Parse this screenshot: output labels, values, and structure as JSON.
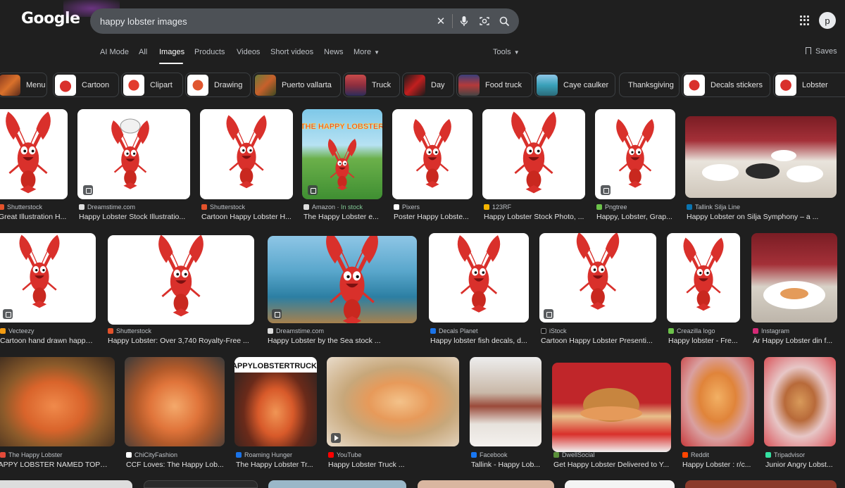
{
  "header": {
    "logo": "Google",
    "search_value": "happy lobster images",
    "avatar_letter": "p"
  },
  "nav": {
    "tabs": [
      "AI Mode",
      "All",
      "Images",
      "Products",
      "Videos",
      "Short videos",
      "News",
      "More"
    ],
    "active_tab": "Images",
    "tools": "Tools",
    "saves": "Saves"
  },
  "chips": [
    "Menu",
    "Cartoon",
    "Clipart",
    "Drawing",
    "Puerto vallarta",
    "Truck",
    "Day",
    "Food truck",
    "Caye caulker",
    "Thanksgiving",
    "Decals stickers",
    "Lobster"
  ],
  "results": {
    "row1": [
      {
        "source": "Shutterstock",
        "title": "Great Illustration H..."
      },
      {
        "source": "Dreamstime.com",
        "title": "Happy Lobster Stock Illustratio..."
      },
      {
        "source": "Shutterstock",
        "title": "Cartoon Happy Lobster H..."
      },
      {
        "source": "Amazon",
        "stock": "In stock",
        "title": "The Happy Lobster e..."
      },
      {
        "source": "Pixers",
        "title": "Poster Happy Lobste..."
      },
      {
        "source": "123RF",
        "title": "Happy Lobster Stock Photo, ..."
      },
      {
        "source": "Pngtree",
        "title": "Happy, Lobster, Grap..."
      },
      {
        "source": "Tallink Silja Line",
        "title": "Happy Lobster on Silja Symphony – a ..."
      }
    ],
    "row2": [
      {
        "source": "Vecteezy",
        "title": "Cartoon hand drawn happy ..."
      },
      {
        "source": "Shutterstock",
        "title": "Happy Lobster: Over 3,740 Royalty-Free ..."
      },
      {
        "source": "Dreamstime.com",
        "title": "Happy Lobster by the Sea stock ..."
      },
      {
        "source": "Decals Planet",
        "title": "Happy lobster fish decals, d..."
      },
      {
        "source": "iStock",
        "title": "Cartoon Happy Lobster Presenti..."
      },
      {
        "source": "Creazilla logo",
        "title": "Happy lobster - Fre..."
      },
      {
        "source": "Instagram",
        "title": "Är Happy Lobster din f..."
      }
    ],
    "row3": [
      {
        "source": "The Happy Lobster",
        "title": "HAPPY LOBSTER NAMED TOP ..."
      },
      {
        "source": "ChiCityFashion",
        "title": "CCF Loves: The Happy Lob..."
      },
      {
        "source": "Roaming Hunger",
        "title": "The Happy Lobster Tr..."
      },
      {
        "source": "YouTube",
        "title": "Happy Lobster Truck ..."
      },
      {
        "source": "Facebook",
        "title": "Tallink - Happy Lob..."
      },
      {
        "source": "DwellSocial",
        "title": "Get Happy Lobster Delivered to Y..."
      },
      {
        "source": "Reddit",
        "title": "Happy Lobster : r/c..."
      },
      {
        "source": "Tripadvisor",
        "title": "Junior Angry Lobst..."
      }
    ]
  },
  "image_text": {
    "book_title": "THE HAPPY LOBSTER",
    "truck_sign": "HAPPYLOBSTERTRUCK.C"
  },
  "colors": {
    "background": "#1f1f1f",
    "search_bg": "#4d5156",
    "lobster_red": "#d9302b",
    "in_stock_green": "#81c995"
  }
}
